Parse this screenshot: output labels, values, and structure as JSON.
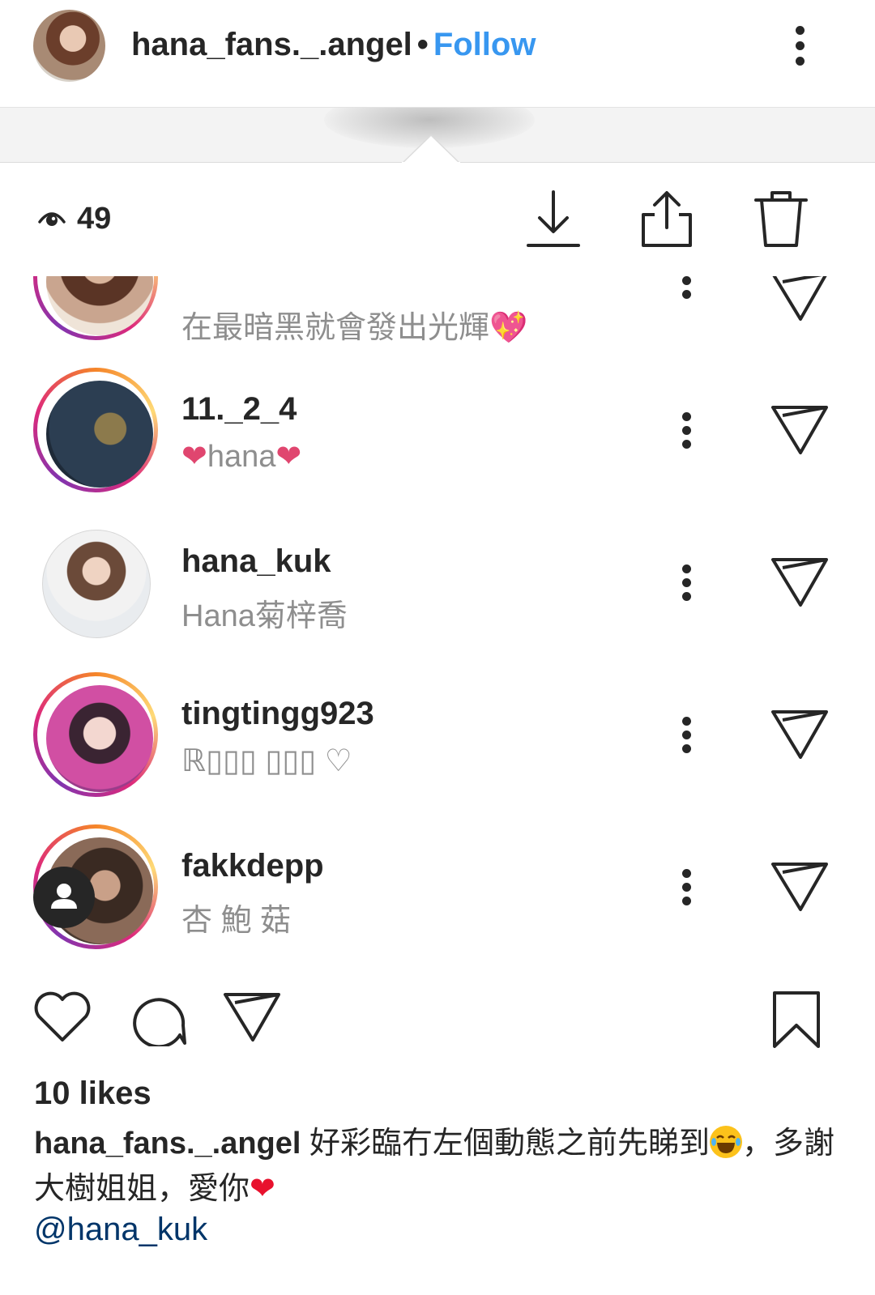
{
  "header": {
    "username": "hana_fans._.angel",
    "separator": "•",
    "follow_label": "Follow"
  },
  "viewer_toolbar": {
    "view_count": "49",
    "icons": [
      "eye-icon",
      "download-icon",
      "share-icon",
      "trash-icon"
    ]
  },
  "viewers": [
    {
      "username": "",
      "subtitle": "在最暗黑就會發出光輝💖",
      "ring": true
    },
    {
      "username": "11._2_4",
      "subtitle_heart_left": "❤",
      "subtitle": "hana",
      "subtitle_heart_right": "❤",
      "ring": true
    },
    {
      "username": "hana_kuk",
      "subtitle": "Hana菊梓喬",
      "ring": false
    },
    {
      "username": "tingtingg923",
      "subtitle": "ℝ▯▯▯ ▯▯▯ ♡",
      "ring": true
    },
    {
      "username": "fakkdepp",
      "subtitle": "杏 鮑 菇",
      "ring": true
    }
  ],
  "actions": {
    "icons": [
      "heart-icon",
      "comment-icon",
      "send-icon",
      "bookmark-icon"
    ]
  },
  "likes": "10 likes",
  "caption": {
    "username": "hana_fans._.angel",
    "text_before_emoji": "好彩臨冇左個動態之前先睇到",
    "text_after_emoji": "，多謝大樹姐姐，愛你",
    "heart_emoji": "❤"
  },
  "mention": "@hana_kuk",
  "colors": {
    "link_blue": "#3897f0",
    "mention_blue": "#003569",
    "text_dark": "#262626",
    "text_grey": "#8e8e8e",
    "heart_pink": "#e0466f"
  }
}
